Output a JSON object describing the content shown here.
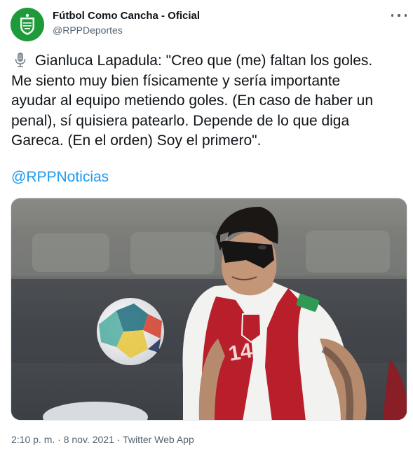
{
  "author": {
    "name": "Fútbol Como Cancha - Oficial",
    "handle": "@RPPDeportes"
  },
  "icons": {
    "avatar": "team-crest-logo",
    "more": "more-options-icon",
    "mic": "microphone-emoji"
  },
  "tweet": {
    "lines": [
      "Gianluca Lapadula: \"Creo que (me) faltan los goles.",
      "Me siento muy bien físicamente y sería importante",
      "ayudar al equipo metiendo goles. (En caso de haber un",
      "penal), sí quisiera patearlo. Depende de lo que diga",
      "Gareca. (En el orden) Soy el primero\"."
    ],
    "mention": "@RPPNoticias"
  },
  "meta": {
    "time": "2:10 p. m.",
    "separator": "·",
    "date": "8 nov. 2021",
    "source": "Twitter Web App"
  },
  "colors": {
    "link": "#1d9bf0",
    "secondary_text": "#536471",
    "avatar_bg": "#1f9a3a"
  }
}
